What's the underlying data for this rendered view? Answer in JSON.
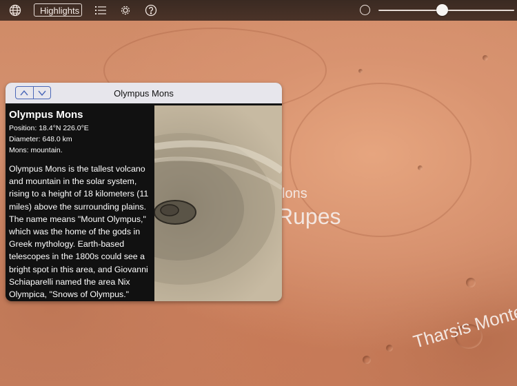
{
  "toolbar": {
    "globe_icon": "globe-icon",
    "highlights_label": "Highlights",
    "list_icon": "list-icon",
    "settings_icon": "gear-icon",
    "help_icon": "help-icon",
    "slider_value": 0.47
  },
  "map_labels": {
    "mons_fragment": "lons",
    "rupes_fragment": "Rupes",
    "tharsis": "Tharsis Monte"
  },
  "panel": {
    "title": "Olympus Mons",
    "feature_name": "Olympus Mons",
    "position": "Position: 18.4°N 226.0°E",
    "diameter": "Diameter: 648.0 km",
    "type": "Mons: mountain.",
    "description": "Olympus Mons is the tallest volcano and mountain in the solar system, rising to a height of 18 kilometers (11 miles) above the surrounding plains. The name means \"Mount Olympus,\" which was the home of the gods in Greek mythology. Earth-based telescopes in the 1800s could see a bright spot in this area, and Giovanni Schiaparelli named the area Nix Olympica, \"Snows of Olympus.\""
  }
}
